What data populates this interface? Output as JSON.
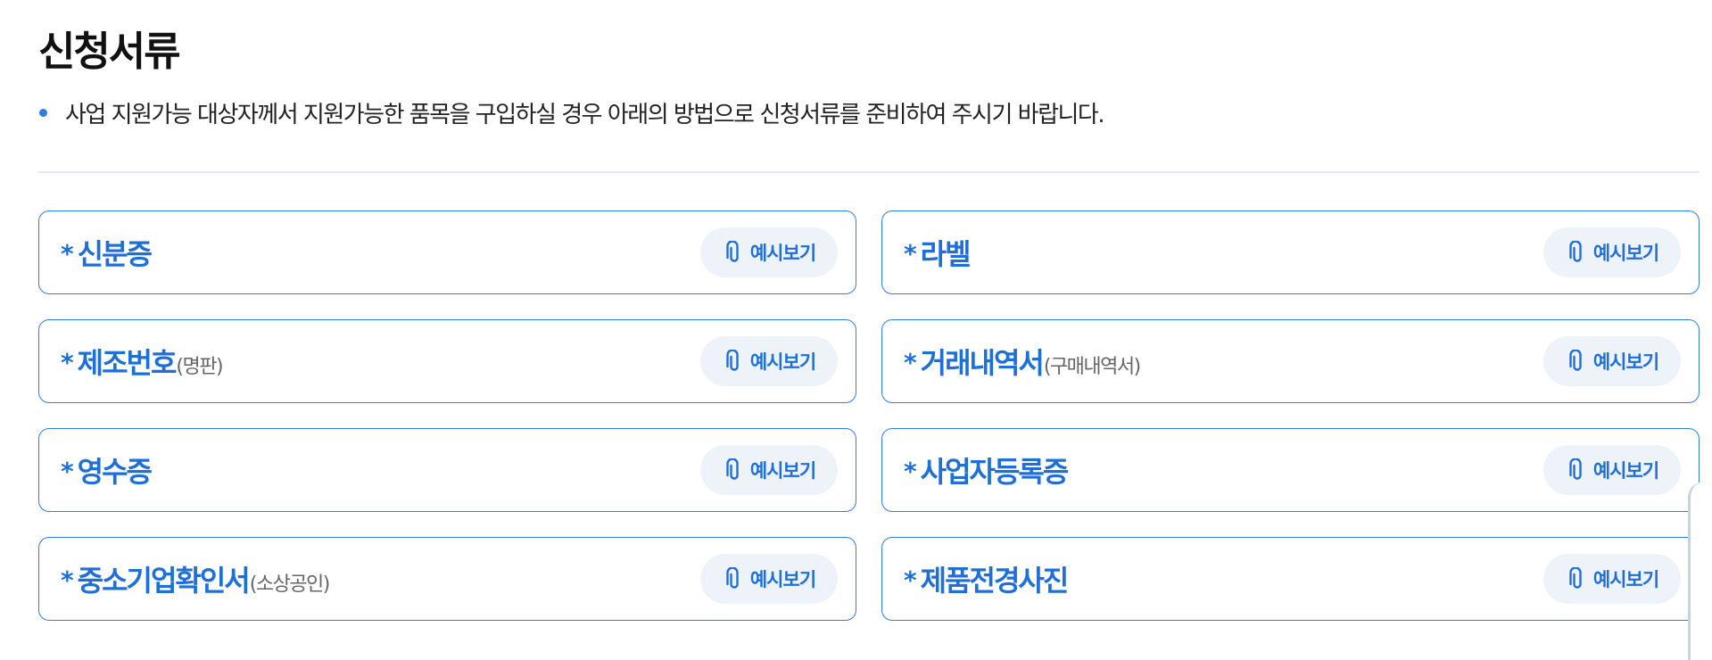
{
  "section": {
    "title": "신청서류",
    "description": "사업 지원가능 대상자께서 지원가능한 품목을 구입하실 경우 아래의 방법으로 신청서류를 준비하여 주시기 바랍니다."
  },
  "documents": [
    {
      "required_mark": "*",
      "label": "신분증",
      "sub": "",
      "button_label": "예시보기"
    },
    {
      "required_mark": "*",
      "label": "라벨",
      "sub": "",
      "button_label": "예시보기"
    },
    {
      "required_mark": "*",
      "label": "제조번호",
      "sub": "(명판)",
      "button_label": "예시보기"
    },
    {
      "required_mark": "*",
      "label": "거래내역서",
      "sub": "(구매내역서)",
      "button_label": "예시보기"
    },
    {
      "required_mark": "*",
      "label": "영수증",
      "sub": "",
      "button_label": "예시보기"
    },
    {
      "required_mark": "*",
      "label": "사업자등록증",
      "sub": "",
      "button_label": "예시보기"
    },
    {
      "required_mark": "*",
      "label": "중소기업확인서",
      "sub": "(소상공인)",
      "button_label": "예시보기"
    },
    {
      "required_mark": "*",
      "label": "제품전경사진",
      "sub": "",
      "button_label": "예시보기"
    }
  ],
  "icons": {
    "button_icon": "paperclip-icon",
    "bullet_icon": "bullet-dot-icon"
  },
  "colors": {
    "accent": "#1f6fd8",
    "card_border": "#2f7de1",
    "button_bg": "#eef3f9",
    "divider": "#e6e8eb"
  }
}
